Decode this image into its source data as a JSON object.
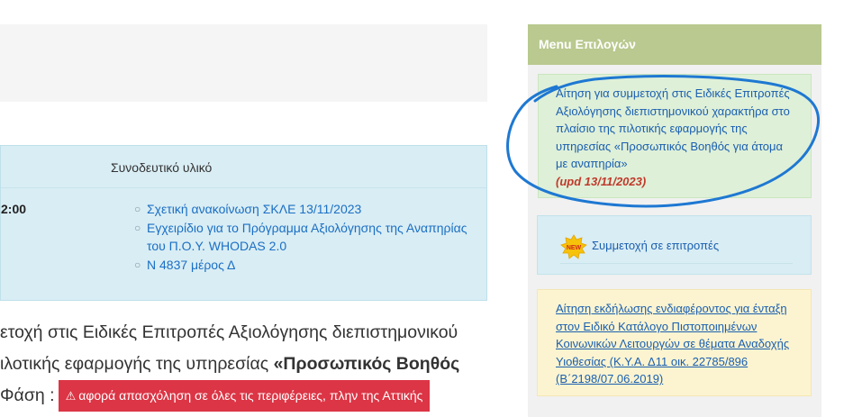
{
  "main": {
    "table": {
      "header": "Συνοδευτικό υλικό",
      "time": "2:00",
      "links": [
        "Σχετική ανακοίνωση ΣΚΛΕ 13/11/2023",
        "Εγχειρίδιο για το Πρόγραμμα Αξιολόγησης της Αναπηρίας του Π.Ο.Υ. WHODAS 2.0",
        "Ν 4837 μέρος Δ"
      ]
    },
    "body": {
      "line1": "ετοχή στις Ειδικές Επιτροπές Αξιολόγησης διεπιστημονικού",
      "line2_plain": "ιλοτικής εφαρμογής της υπηρεσίας ",
      "line2_bold": "«Προσωπικός Βοηθός",
      "line3_plain": "Φάση :",
      "alert": "αφορά απασχόληση σε όλες τις περιφέρειες, πλην της Αττικής"
    }
  },
  "sidebar": {
    "title": "Menu Επιλογών",
    "cards": {
      "green_text": "Αίτηση για συμμετοχή στις Ειδικές Επιτροπές Αξιολόγησης διεπιστημονικού χαρακτήρα στο πλαίσιο της πιλοτικής εφαρμογής της υπηρεσίας «Προσωπικός Βοηθός για άτομα με αναπηρία»",
      "green_update": "(upd 13/11/2023)",
      "blue_badge": "NEW",
      "blue_link": "Συμμετοχή σε επιτροπές",
      "yellow_text": "Αίτηση εκδήλωσης ενδιαφέροντος για ένταξη στον Ειδικό Κατάλογο Πιστοποιημένων Κοινωνικών Λειτουργών σε θέματα Αναδοχής Υιοθεσίας (Κ.Υ.Α. Δ11 οικ. 22785/896 (Β΄2198/07.06.2019)"
    }
  },
  "colors": {
    "sidebar_header": "#b9c98f",
    "link": "#1a5fb0",
    "alert": "#dc3545",
    "annotation": "#1e78d2"
  }
}
